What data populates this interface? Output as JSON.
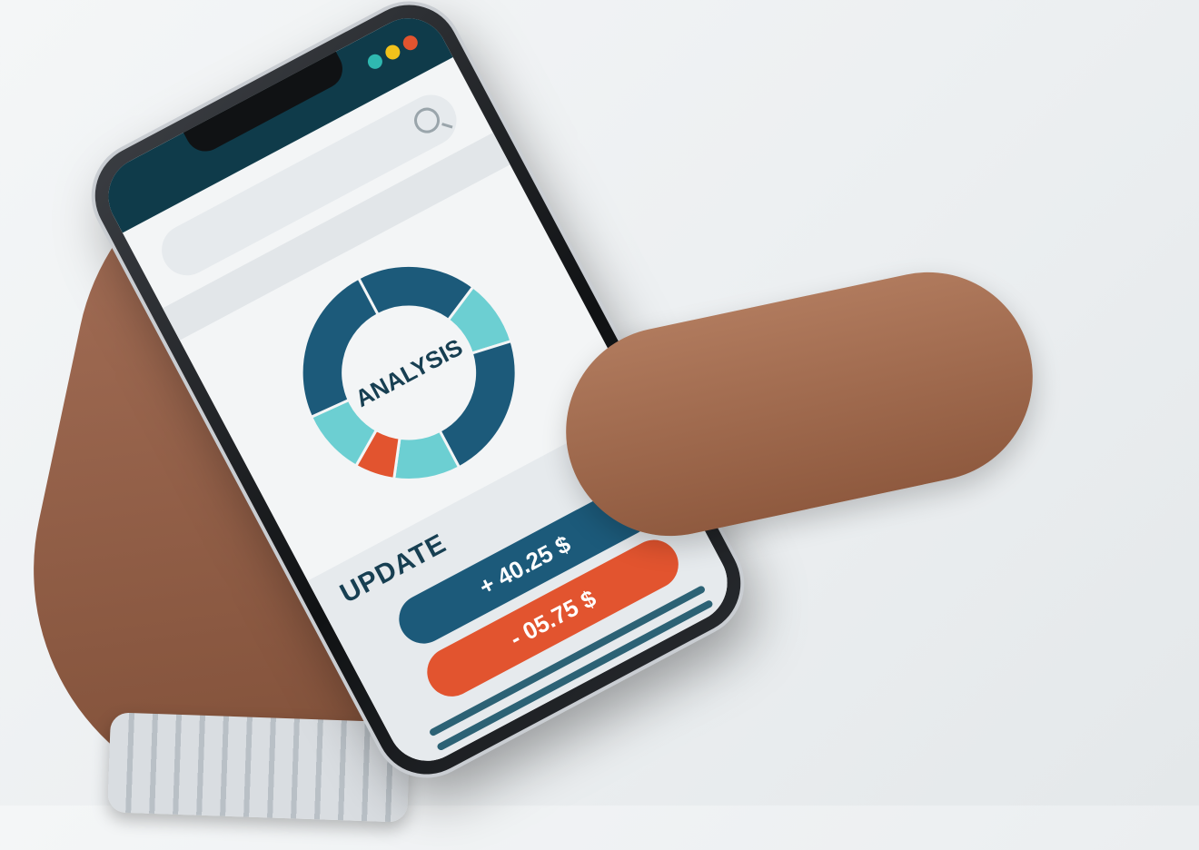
{
  "chart_data": {
    "type": "pie",
    "title": "ANALYSIS",
    "colors": [
      "#1c5a7a",
      "#6ccfd2",
      "#e2542f"
    ],
    "slices": [
      {
        "label": "",
        "value": 18,
        "color": "#1c5a7a"
      },
      {
        "label": "",
        "value": 10,
        "color": "#6ccfd2"
      },
      {
        "label": "",
        "value": 22,
        "color": "#1c5a7a"
      },
      {
        "label": "",
        "value": 10,
        "color": "#6ccfd2"
      },
      {
        "label": "",
        "value": 6,
        "color": "#e2542f"
      },
      {
        "label": "",
        "value": 10,
        "color": "#6ccfd2"
      },
      {
        "label": "",
        "value": 24,
        "color": "#1c5a7a"
      }
    ]
  },
  "update": {
    "title": "UPDATE",
    "plus_amount": "+ 40.25 $",
    "minus_amount": "- 05.75 $"
  },
  "status_dots": [
    "#2fb8b0",
    "#f2c21b",
    "#e2542f"
  ],
  "search": {
    "icon": "search-icon"
  }
}
